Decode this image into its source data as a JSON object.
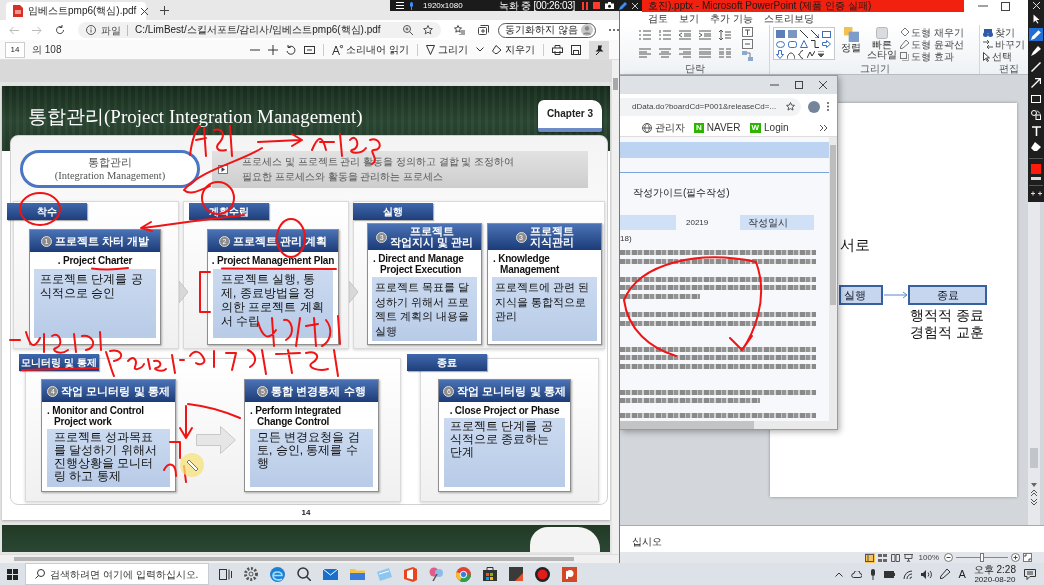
{
  "recorder": {
    "resolution": "1920x1080",
    "status": "녹화 중 [00:26:03]"
  },
  "pdf_browser": {
    "tab": {
      "title": "임베스트pmp6(핵심).pdf"
    },
    "address_bar": {
      "scheme": "파일",
      "url": "C:/LimBest/스킬서포트/감리사/임베스트pmp6(핵심).pdf"
    },
    "profile_button": "동기화하지 않음",
    "pdf_toolbar": {
      "page": "14",
      "page_count": "의 108",
      "read_aloud": "소리내어 읽기",
      "draw": "그리기",
      "erase": "지우기",
      "pinned": true
    }
  },
  "slide": {
    "title": "통합관리(Project Integration Management)",
    "chapter": "Chapter 3",
    "concept": [
      "통합관리",
      "(Integration Management)"
    ],
    "definition": [
      "프로세스 및 프로젝트 관리 활동을 정의하고 결합 및 조정하여",
      "필요한 프로세스와 활동을 관리하는 프로세스"
    ],
    "groups": [
      {
        "label": "착수",
        "processes": [
          {
            "number": "1",
            "title": [
              "프로젝트 차터 개발"
            ],
            "output": [
              ". Project Charter"
            ],
            "description": "프로젝트 단계를 공식적으로 승인"
          }
        ]
      },
      {
        "label": "계획수립",
        "processes": [
          {
            "number": "2",
            "title": [
              "프로젝트 관리 계획"
            ],
            "output": [
              ". Project Management Plan"
            ],
            "description": "프로젝트 실행, 통제, 종료방법을 정의한 프로젝트 계획서 수립"
          }
        ]
      },
      {
        "label": "실행",
        "processes": [
          {
            "number": "3",
            "title": [
              "프로젝트",
              "작업지시 및 관리"
            ],
            "output": [
              ". Direct and Manage",
              "Project Execution"
            ],
            "description": "프로젝트 목표를 달성하기 위해서 프로젝트 계획의 내용을 실행"
          },
          {
            "number": "3",
            "title": [
              "프로젝트",
              "지식관리"
            ],
            "output": [
              ". Knowledge",
              "Management"
            ],
            "description": "프로젝트에 관련 된 지식을 통합적으로 관리"
          }
        ]
      },
      {
        "label": "모니터링 및 통제",
        "processes": [
          {
            "number": "4",
            "title": [
              "작업 모니터링 및 통제"
            ],
            "output": [
              ". Monitor and Control",
              "Project work"
            ],
            "description": "프로젝트 성과목표를 달성하기 위해서 진행상황을 모니터링 하고 통제"
          },
          {
            "number": "5",
            "title": [
              "통합 변경통제 수행"
            ],
            "output": [
              ". Perform Integrated",
              "Change Control"
            ],
            "description": "모든 변경요청을 검토, 승인, 통제를 수행"
          }
        ]
      },
      {
        "label": "종료",
        "processes": [
          {
            "number": "6",
            "title": [
              "작업 모니터링 및 통제"
            ],
            "output": [
              ". Close Project or Phase"
            ],
            "description": "프로젝트 단계를 공식적으로 종료하는 단계"
          }
        ]
      }
    ],
    "page_number": "14"
  },
  "presentation_app": {
    "title": "호진).pptx - Microsoft PowerPoint (제품 인증 실패)",
    "menu": [
      "검토",
      "보기",
      "추가 기능",
      "스토리보딩"
    ],
    "ribbon": {
      "paragraph_group": "단락",
      "drawing_group": {
        "label": "그리기",
        "arrange": "정렬",
        "quick_styles": "빠른 스타일",
        "shape_options": [
          "도형 채우기",
          "도형 윤곽선",
          "도형 효과"
        ]
      },
      "editing_group": {
        "label": "편집",
        "commands": [
          "찾기",
          "바꾸기",
          "선택"
        ]
      }
    },
    "slide": {
      "text": "서로",
      "steps": [
        "실행",
        "종료"
      ],
      "caption": [
        "행적적 종료",
        "경험적 교훈"
      ]
    },
    "notes": "십시오",
    "views": [
      {
        "kind": "normal",
        "selected": true
      },
      {
        "kind": "sorter",
        "selected": false
      },
      {
        "kind": "reading",
        "selected": false
      },
      {
        "kind": "show",
        "selected": false
      }
    ],
    "zoom": {
      "reading": "100%",
      "level": 0.5
    }
  },
  "web_browser": {
    "url": "dData.do?boardCd=P001&releaseCd=...",
    "bookmarks": [
      {
        "kind": "globe",
        "label": "관리자"
      },
      {
        "kind": "badge",
        "badge": "N",
        "label": "NAVER"
      },
      {
        "kind": "badge",
        "badge": "W",
        "label": "Login"
      }
    ],
    "page": {
      "heading": "작성가이드(필수작성)",
      "table": [
        {
          "kind": "value",
          "text": "20219"
        },
        {
          "kind": "header",
          "text": "작성일시"
        }
      ],
      "note": "18)"
    }
  },
  "ink_toolbar": {
    "tools": [
      {
        "kind": "cursor",
        "selected": false
      },
      {
        "kind": "pen",
        "selected": true
      },
      {
        "kind": "marker",
        "selected": false
      },
      {
        "kind": "line",
        "selected": false
      },
      {
        "kind": "arrow",
        "selected": false
      },
      {
        "kind": "rectangle",
        "selected": false
      },
      {
        "kind": "shapes",
        "selected": false
      },
      {
        "kind": "text",
        "selected": false
      },
      {
        "kind": "eraser",
        "selected": false
      }
    ]
  },
  "taskbar": {
    "search": {
      "placeholder": "검색하려면 여기에 입력하십시오."
    },
    "input_mode": "A",
    "time": "오후 2:28",
    "date": "2020-08-20"
  }
}
